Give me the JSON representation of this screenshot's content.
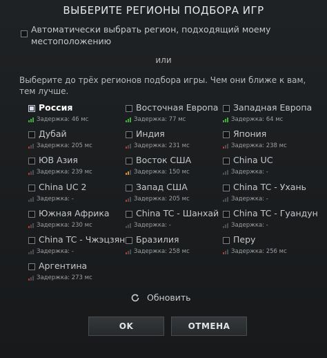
{
  "dialog": {
    "title": "ВЫБЕРИТЕ РЕГИОНЫ ПОДБОРА ИГР",
    "auto_select_label": "Автоматически выбрать регион, подходящий моему местоположению",
    "or_label": "или",
    "instruction": "Выберите до трёх регионов подбора игры. Чем они ближе к вам, тем лучше.",
    "refresh_label": "Обновить",
    "ok_label": "OK",
    "cancel_label": "ОТМЕНА"
  },
  "colors": {
    "good": "#3fae3a",
    "medium": "#e0902a",
    "bad": "#c0392b",
    "none": "#4a4e52"
  },
  "regions": [
    {
      "name": "Россия",
      "latency": "Задержка: 46 мс",
      "signal": "good",
      "selected": true
    },
    {
      "name": "Восточная Европа",
      "latency": "Задержка: 77 мс",
      "signal": "good",
      "selected": false
    },
    {
      "name": "Западная Европа",
      "latency": "Задержка: 64 мс",
      "signal": "good",
      "selected": false
    },
    {
      "name": "Дубай",
      "latency": "Задержка: 205 мс",
      "signal": "bad",
      "selected": false
    },
    {
      "name": "Индия",
      "latency": "Задержка: 231 мс",
      "signal": "bad",
      "selected": false
    },
    {
      "name": "Япония",
      "latency": "Задержка: 238 мс",
      "signal": "bad",
      "selected": false
    },
    {
      "name": "ЮВ Азия",
      "latency": "Задержка: 239 мс",
      "signal": "bad",
      "selected": false
    },
    {
      "name": "Восток США",
      "latency": "Задержка: 150 мс",
      "signal": "medium",
      "selected": false
    },
    {
      "name": "China UC",
      "latency": "Задержка: -",
      "signal": "none",
      "selected": false
    },
    {
      "name": "China UC 2",
      "latency": "Задержка: -",
      "signal": "none",
      "selected": false
    },
    {
      "name": "Запад США",
      "latency": "Задержка: 205 мс",
      "signal": "bad",
      "selected": false
    },
    {
      "name": "China TC - Ухань",
      "latency": "Задержка: -",
      "signal": "none",
      "selected": false
    },
    {
      "name": "Южная Африка",
      "latency": "Задержка: 230 мс",
      "signal": "bad",
      "selected": false
    },
    {
      "name": "China TC - Шанхай",
      "latency": "Задержка: -",
      "signal": "none",
      "selected": false
    },
    {
      "name": "China TC - Гуандун",
      "latency": "Задержка: -",
      "signal": "none",
      "selected": false
    },
    {
      "name": "China TC - Чжэцзян",
      "latency": "Задержка: -",
      "signal": "none",
      "selected": false
    },
    {
      "name": "Бразилия",
      "latency": "Задержка: 258 мс",
      "signal": "bad",
      "selected": false
    },
    {
      "name": "Перу",
      "latency": "Задержка: 256 мс",
      "signal": "bad",
      "selected": false
    },
    {
      "name": "Аргентина",
      "latency": "Задержка: 273 мс",
      "signal": "bad",
      "selected": false
    }
  ]
}
